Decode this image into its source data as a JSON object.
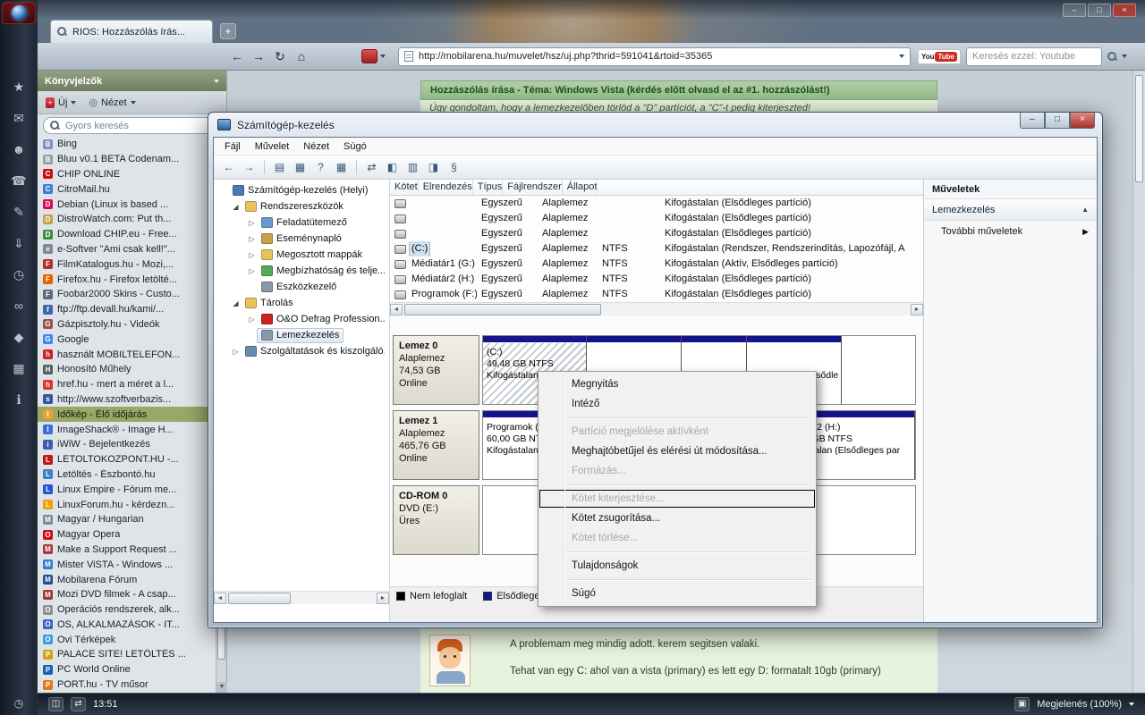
{
  "opera": {
    "window_controls": {
      "minimize": "–",
      "maximize": "□",
      "close": "×"
    },
    "tab": {
      "title": "RIOS: Hozzászólás írás..."
    },
    "new_tab": "+",
    "address_url": "http://mobilarena.hu/muvelet/hsz/uj.php?thrid=591041&rtoid=35365",
    "search": {
      "placeholder": "Keresés ezzel: Youtube",
      "logo_you": "You",
      "logo_tube": "Tube"
    },
    "status": {
      "clock": "13:51",
      "zoom_label": "Megjelenés (100%)"
    },
    "side_icons": [
      {
        "name": "bookmarks-panel-icon",
        "glyph": "★"
      },
      {
        "name": "mail-panel-icon",
        "glyph": "✉"
      },
      {
        "name": "contacts-panel-icon",
        "glyph": "☻"
      },
      {
        "name": "chat-panel-icon",
        "glyph": "☎"
      },
      {
        "name": "notes-panel-icon",
        "glyph": "✎"
      },
      {
        "name": "transfers-panel-icon",
        "glyph": "⇓"
      },
      {
        "name": "history-panel-icon",
        "glyph": "◷"
      },
      {
        "name": "links-panel-icon",
        "glyph": "∞"
      },
      {
        "name": "widgets-panel-icon",
        "glyph": "◆"
      },
      {
        "name": "windows-panel-icon",
        "glyph": "▦"
      },
      {
        "name": "info-panel-icon",
        "glyph": "ℹ"
      }
    ],
    "panel": {
      "title": "Könyvjelzők",
      "new_button": "Új",
      "view_button": "Nézet",
      "quick_search": "Gyors keresés",
      "bookmarks": [
        {
          "label": "Bing",
          "color": "#7a93b8",
          "initial": "B",
          "state": ""
        },
        {
          "label": "Bluu v0.1 BETA Codenam...",
          "color": "#9aa0a8",
          "initial": "B",
          "state": ""
        },
        {
          "label": "CHIP ONLINE",
          "color": "#cc1111",
          "initial": "C",
          "state": ""
        },
        {
          "label": "CitroMail.hu",
          "color": "#3d7edb",
          "initial": "C",
          "state": ""
        },
        {
          "label": "Debian (Linux is based ...",
          "color": "#d70a53",
          "initial": "D",
          "state": ""
        },
        {
          "label": "DistroWatch.com: Put th...",
          "color": "#caa04a",
          "initial": "D",
          "state": ""
        },
        {
          "label": "Download CHIP.eu - Free...",
          "color": "#3e8e41",
          "initial": "D",
          "state": ""
        },
        {
          "label": "e-Softver \"Ami csak kell!\"...",
          "color": "#7d8894",
          "initial": "e",
          "state": ""
        },
        {
          "label": "FilmKatalogus.hu - Mozi,...",
          "color": "#b03030",
          "initial": "F",
          "state": ""
        },
        {
          "label": "Firefox.hu - Firefox letölté...",
          "color": "#e66000",
          "initial": "F",
          "state": ""
        },
        {
          "label": "Foobar2000 Skins - Custo...",
          "color": "#5a6b7c",
          "initial": "F",
          "state": ""
        },
        {
          "label": "ftp://ftp.devall.hu/kami/...",
          "color": "#3d66b0",
          "initial": "f",
          "state": ""
        },
        {
          "label": "Gázpisztoly.hu - Videók",
          "color": "#a05050",
          "initial": "G",
          "state": ""
        },
        {
          "label": "Google",
          "color": "#4285f4",
          "initial": "G",
          "state": ""
        },
        {
          "label": "használt MOBILTELEFON...",
          "color": "#cc2222",
          "initial": "h",
          "state": ""
        },
        {
          "label": "Honosító Műhely",
          "color": "#555e66",
          "initial": "H",
          "state": ""
        },
        {
          "label": "href.hu - mert a méret a l...",
          "color": "#e03030",
          "initial": "h",
          "state": ""
        },
        {
          "label": "http://www.szoftverbazis...",
          "color": "#34569a",
          "initial": "s",
          "state": ""
        },
        {
          "label": "Időkép - Élő időjárás",
          "color": "#f0a030",
          "initial": "I",
          "state": "selected"
        },
        {
          "label": "ImageShack® - Image H...",
          "color": "#3a6fd8",
          "initial": "I",
          "state": ""
        },
        {
          "label": "iWiW - Bejelentkezés",
          "color": "#3a5fa8",
          "initial": "i",
          "state": ""
        },
        {
          "label": "LETOLTOKOZPONT.HU -...",
          "color": "#c01818",
          "initial": "L",
          "state": ""
        },
        {
          "label": "Letöltés - Észbontó.hu",
          "color": "#3a7fc8",
          "initial": "L",
          "state": ""
        },
        {
          "label": "Linux Empire - Fórum me...",
          "color": "#2255cc",
          "initial": "L",
          "state": ""
        },
        {
          "label": "LinuxForum.hu - kérdezn...",
          "color": "#f0a000",
          "initial": "L",
          "state": ""
        },
        {
          "label": "Magyar / Hungarian",
          "color": "#7a8a9a",
          "initial": "M",
          "state": ""
        },
        {
          "label": "Magyar Opera",
          "color": "#cc0f16",
          "initial": "O",
          "state": ""
        },
        {
          "label": "Make a Support Request ...",
          "color": "#b03344",
          "initial": "M",
          "state": ""
        },
        {
          "label": "Mister ViSTA - Windows ...",
          "color": "#2a7fd4",
          "initial": "M",
          "state": ""
        },
        {
          "label": "Mobilarena Fórum",
          "color": "#2a4a8a",
          "initial": "M",
          "state": ""
        },
        {
          "label": "Mozi DVD filmek - A csap...",
          "color": "#a03333",
          "initial": "M",
          "state": ""
        },
        {
          "label": "Operációs rendszerek, alk...",
          "color": "#8a8f96",
          "initial": "O",
          "state": ""
        },
        {
          "label": "OS, ALKALMAZÁSOK - IT...",
          "color": "#3a66c0",
          "initial": "O",
          "state": ""
        },
        {
          "label": "Ovi Térképek",
          "color": "#36a0e0",
          "initial": "O",
          "state": ""
        },
        {
          "label": "PALACE SITE! LETÖLTÉS ...",
          "color": "#d4a017",
          "initial": "P",
          "state": ""
        },
        {
          "label": "PC World Online",
          "color": "#1a5fb0",
          "initial": "P",
          "state": ""
        },
        {
          "label": "PORT.hu - TV műsor",
          "color": "#e87511",
          "initial": "P",
          "state": ""
        }
      ]
    }
  },
  "page": {
    "header": "Hozzászólás írása - Téma: Windows Vista (kérdés előtt olvasd el az #1. hozzászólást!)",
    "quote": "Úgy gondoltam, hogy a lemezkezelőben törlöd a \"D\" partíciót, a \"C\"-t pedig kiterjeszted!",
    "post_line1": "A problemam meg mindig adott. kerem segitsen valaki.",
    "post_line2": "Tehat van egy C: ahol van a vista (primary) es lett egy D: formatalt 10gb (primary)"
  },
  "cm": {
    "title": "Számítógép-kezelés",
    "window_controls": {
      "minimize": "–",
      "maximize": "□",
      "close": "×"
    },
    "menus": [
      {
        "label": "Fájl"
      },
      {
        "label": "Művelet"
      },
      {
        "label": "Nézet"
      },
      {
        "label": "Súgó"
      }
    ],
    "toolbar": [
      {
        "glyph": "←",
        "name": "back-icon",
        "state": ""
      },
      {
        "glyph": "→",
        "name": "forward-icon",
        "state": ""
      },
      {
        "glyph": "",
        "name": "separator",
        "state": "tsep"
      },
      {
        "glyph": "▤",
        "name": "show-tree-icon",
        "state": ""
      },
      {
        "glyph": "▦",
        "name": "console-icon",
        "state": ""
      },
      {
        "glyph": "?",
        "name": "help-icon",
        "state": ""
      },
      {
        "glyph": "▦",
        "name": "properties-icon",
        "state": ""
      },
      {
        "glyph": "",
        "name": "separator",
        "state": "tsep"
      },
      {
        "glyph": "⇄",
        "name": "refresh-icon",
        "state": ""
      },
      {
        "glyph": "◧",
        "name": "rescan-icon",
        "state": ""
      },
      {
        "glyph": "▥",
        "name": "list-view-icon",
        "state": ""
      },
      {
        "glyph": "◨",
        "name": "graph-view-icon",
        "state": ""
      },
      {
        "glyph": "§",
        "name": "script-icon",
        "state": ""
      }
    ],
    "tree": [
      {
        "arrow": "",
        "icon": "#4a7ab5",
        "label": "Számítógép-kezelés (Helyi)",
        "state": "lvl0"
      },
      {
        "arrow": "◢",
        "icon": "#e8c35c",
        "label": "Rendszereszközök",
        "state": "lvl1"
      },
      {
        "arrow": "▷",
        "icon": "#6a9ad0",
        "label": "Feladatütemező",
        "state": "lvl2"
      },
      {
        "arrow": "▷",
        "icon": "#c8a050",
        "label": "Eseménynapló",
        "state": "lvl2"
      },
      {
        "arrow": "▷",
        "icon": "#e8c35c",
        "label": "Megosztott mappák",
        "state": "lvl2"
      },
      {
        "arrow": "▷",
        "icon": "#58a858",
        "label": "Megbízhatóság és telje...",
        "state": "lvl2"
      },
      {
        "arrow": "",
        "icon": "#8a98a8",
        "label": "Eszközkezelő",
        "state": "lvl2"
      },
      {
        "arrow": "◢",
        "icon": "#e8c35c",
        "label": "Tárolás",
        "state": "lvl1"
      },
      {
        "arrow": "▷",
        "icon": "#cc2222",
        "label": "O&O Defrag Profession...",
        "state": "lvl2"
      },
      {
        "arrow": "",
        "icon": "#8a98a8",
        "label": "Lemezkezelés",
        "state": "lvl2 selected"
      },
      {
        "arrow": "▷",
        "icon": "#6a8ab0",
        "label": "Szolgáltatások és kiszolgáló...",
        "state": "lvl1"
      }
    ],
    "volumes": {
      "columns": [
        {
          "label": "Kötet"
        },
        {
          "label": "Elrendezés"
        },
        {
          "label": "Típus"
        },
        {
          "label": "Fájlrendszer"
        },
        {
          "label": "Állapot"
        }
      ],
      "rows": [
        {
          "name": "",
          "layout": "Egyszerű",
          "type": "Alaplemez",
          "fs": "",
          "status": "Kifogástalan (Elsődleges partíció)",
          "state": ""
        },
        {
          "name": "",
          "layout": "Egyszerű",
          "type": "Alaplemez",
          "fs": "",
          "status": "Kifogástalan (Elsődleges partíció)",
          "state": ""
        },
        {
          "name": "",
          "layout": "Egyszerű",
          "type": "Alaplemez",
          "fs": "",
          "status": "Kifogástalan (Elsődleges partíció)",
          "state": ""
        },
        {
          "name": "(C:)",
          "layout": "Egyszerű",
          "type": "Alaplemez",
          "fs": "NTFS",
          "status": "Kifogástalan (Rendszer, Rendszerindítás, Lapozófájl, A",
          "state": "selected"
        },
        {
          "name": "Médiatár1 (G:)",
          "layout": "Egyszerű",
          "type": "Alaplemez",
          "fs": "NTFS",
          "status": "Kifogástalan (Aktív, Elsődleges partíció)",
          "state": ""
        },
        {
          "name": "Médiatár2 (H:)",
          "layout": "Egyszerű",
          "type": "Alaplemez",
          "fs": "NTFS",
          "status": "Kifogástalan (Elsődleges partíció)",
          "state": ""
        },
        {
          "name": "Programok (F:)",
          "layout": "Egyszerű",
          "type": "Alaplemez",
          "fs": "NTFS",
          "status": "Kifogástalan (Elsődleges partíció)",
          "state": ""
        }
      ]
    },
    "disks": [
      {
        "name": "Lemez 0",
        "line2": "Alaplemez",
        "line3": "74,53 GB",
        "line4": "Online",
        "partitions": [
          {
            "l1": "(C:)",
            "l2": "49,48 GB NTFS",
            "l3": "Kifogástalan (Rendszer,",
            "state": "selected",
            "width": "24%"
          },
          {
            "l1": "",
            "l2": "",
            "l3": "",
            "state": "",
            "width": "22%"
          },
          {
            "l1": "",
            "l2": "",
            "l3": "",
            "state": "",
            "width": "15%"
          },
          {
            "l1": "",
            "l2": "",
            "l3": "Kifogástalan (Elsődleges partíció)",
            "state": "",
            "width": "22%"
          }
        ]
      },
      {
        "name": "Lemez 1",
        "line2": "Alaplemez",
        "line3": "465,76 GB",
        "line4": "Online",
        "partitions": [
          {
            "l1": "Programok (F:)",
            "l2": "60,00 GB NTFS",
            "l3": "Kifogástalan (Elsődleges partíció)",
            "state": "",
            "width": "51%"
          },
          {
            "l1": "",
            "l2": "",
            "l3": "",
            "state": "",
            "width": "17%"
          },
          {
            "l1": "Médiatár2 (H:)",
            "l2": "205,76 GB NTFS",
            "l3": "Kifogástalan (Elsődleges par",
            "state": "",
            "width": "32%"
          }
        ]
      },
      {
        "name": "CD-ROM 0",
        "line2": "DVD (E:)",
        "line3": "",
        "line4": "Üres",
        "partitions": [
          {
            "l1": "",
            "l2": "",
            "l3": "",
            "state": "nobar",
            "width": "100%"
          }
        ]
      }
    ],
    "legend": [
      {
        "color": "#000000",
        "label": "Nem lefoglalt"
      },
      {
        "color": "#14148c",
        "label": "Elsődleges partíció"
      }
    ],
    "actions": {
      "title": "Műveletek",
      "section": "Lemezkezelés",
      "more": "További műveletek"
    }
  },
  "menu": {
    "items": [
      {
        "label": "Megnyitás",
        "state": ""
      },
      {
        "label": "Intéző",
        "state": ""
      },
      {
        "label": "",
        "state": "sep"
      },
      {
        "label": "Partíció megjelölése aktívként",
        "state": "disabled"
      },
      {
        "label": "Meghajtóbetűjel és elérési út módosítása...",
        "state": ""
      },
      {
        "label": "Formázás...",
        "state": "disabled"
      },
      {
        "label": "",
        "state": "sep"
      },
      {
        "label": "Kötet kiterjesztése...",
        "state": "disabled focused"
      },
      {
        "label": "Kötet zsugorítása...",
        "state": ""
      },
      {
        "label": "Kötet törlése...",
        "state": "disabled"
      },
      {
        "label": "",
        "state": "sep"
      },
      {
        "label": "Tulajdonságok",
        "state": ""
      },
      {
        "label": "",
        "state": "sep"
      },
      {
        "label": "Súgó",
        "state": ""
      }
    ]
  }
}
